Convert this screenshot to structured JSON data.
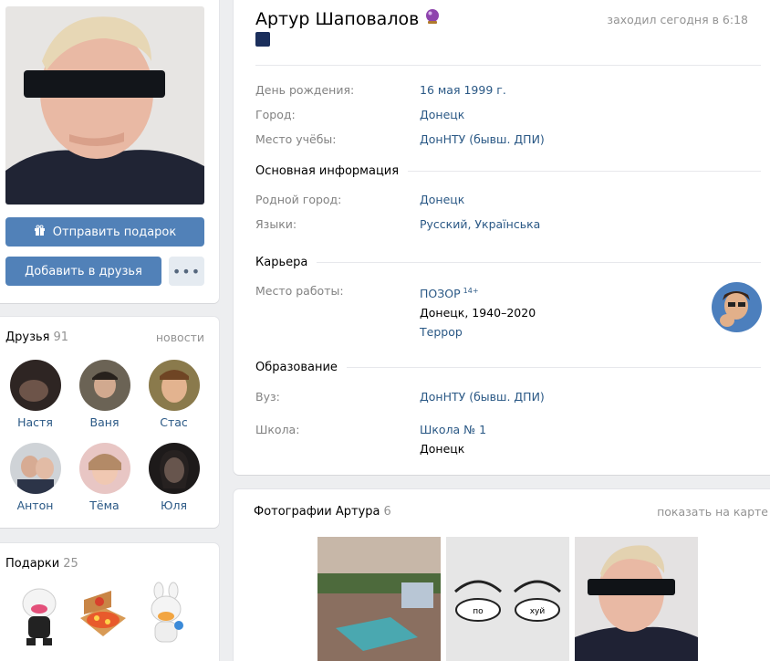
{
  "profile": {
    "gift_button": "Отправить подарок",
    "add_friend_button": "Добавить в друзья",
    "more_button": "•••"
  },
  "friends": {
    "title": "Друзья",
    "count": "91",
    "news_link": "новости",
    "items": [
      {
        "name": "Настя"
      },
      {
        "name": "Ваня"
      },
      {
        "name": "Стас"
      },
      {
        "name": "Антон"
      },
      {
        "name": "Тёма"
      },
      {
        "name": "Юля"
      }
    ]
  },
  "gifts": {
    "title": "Подарки",
    "count": "25"
  },
  "info": {
    "name": "Артур Шаповалов",
    "last_seen": "заходил сегодня в 6:18",
    "birthday_label": "День рождения:",
    "birthday_value": "16 мая 1999 г.",
    "city_label": "Город:",
    "city_value": "Донецк",
    "study_label": "Место учёбы:",
    "study_value": "ДонНТУ (бывш. ДПИ)",
    "main_section": "Основная информация",
    "hometown_label": "Родной город:",
    "hometown_value": "Донецк",
    "languages_label": "Языки:",
    "languages_value": "Русский, Українська",
    "career_section": "Карьера",
    "work_label": "Место работы:",
    "work_value": "ПОЗОР",
    "work_age": "14+",
    "work_place": "Донецк, 1940–2020",
    "work_position": "Террор",
    "education_section": "Образование",
    "university_label": "Вуз:",
    "university_value": "ДонНТУ (бывш. ДПИ)",
    "school_label": "Школа:",
    "school_value": "Школа № 1",
    "school_city": "Донецк"
  },
  "photos": {
    "title": "Фотографии Артура",
    "count": "6",
    "map_link": "показать на карте",
    "eye_words": [
      "по",
      "хуй"
    ]
  },
  "colors": {
    "accent": "#5181b8",
    "link": "#2a5885",
    "muted": "#828282",
    "bg": "#edeef0"
  }
}
